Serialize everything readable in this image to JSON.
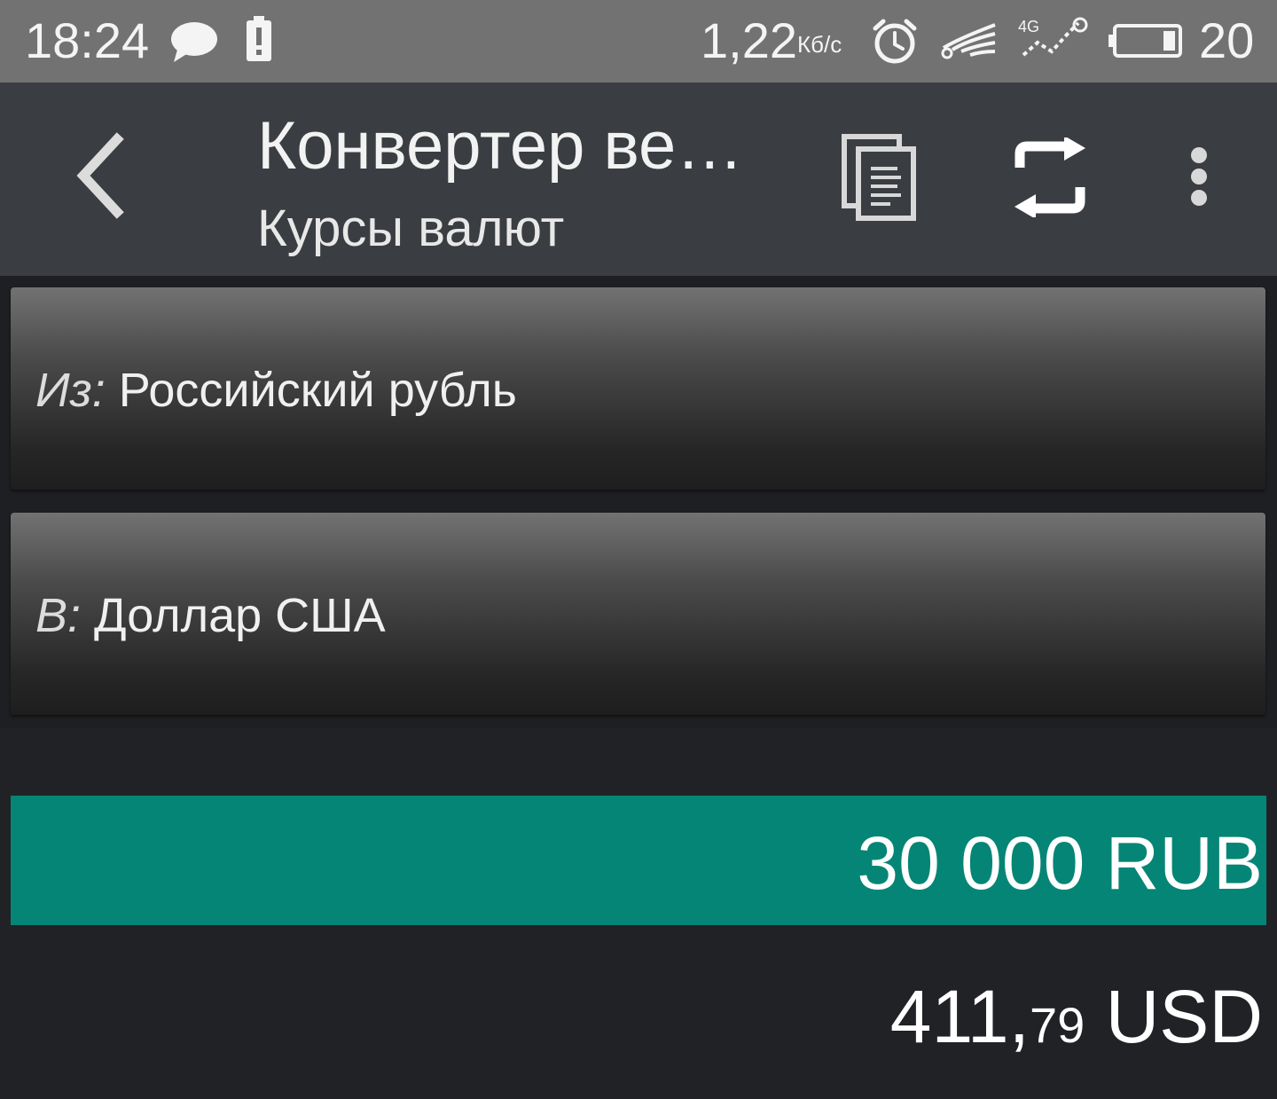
{
  "status_bar": {
    "time": "18:24",
    "network_speed": "1,22",
    "network_speed_unit": "Кб/с",
    "battery_level": "20",
    "network_type": "4G",
    "icons": [
      "message-icon",
      "battery-alert-icon",
      "alarm-icon",
      "signal-icon",
      "4g-icon",
      "battery-icon"
    ]
  },
  "toolbar": {
    "title": "Конвертер ве…",
    "subtitle": "Курсы валют",
    "icons": [
      "back-icon",
      "copy-icon",
      "swap-icon",
      "more-icon"
    ]
  },
  "converter": {
    "from_prefix": "Из:",
    "from_currency": "Российский рубль",
    "to_prefix": "В:",
    "to_currency": "Доллар США",
    "amount": "30 000 RUB",
    "result_integer": "411,",
    "result_cents": "79",
    "result_currency": " USD"
  },
  "colors": {
    "status_bar_bg": "#727272",
    "toolbar_bg": "#3a3d41",
    "page_bg": "#212226",
    "accent": "#058576"
  }
}
